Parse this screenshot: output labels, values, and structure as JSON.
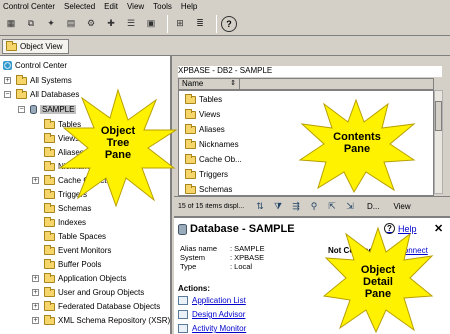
{
  "menu": [
    "Control Center",
    "Selected",
    "Edit",
    "View",
    "Tools",
    "Help"
  ],
  "tab": {
    "label": "Object View"
  },
  "tree": {
    "root": "Control Center",
    "all_systems": "All Systems",
    "all_databases": "All Databases",
    "database": "SAMPLE",
    "items": [
      "Tables",
      "Views",
      "Aliases",
      "Nicknames",
      "Cache Objects",
      "Triggers",
      "Schemas",
      "Indexes",
      "Table Spaces",
      "Event Monitors",
      "Buffer Pools",
      "Application Objects",
      "User and Group Objects",
      "Federated Database Objects",
      "XML Schema Repository (XSR)"
    ]
  },
  "contents": {
    "path": "XPBASE - DB2 - SAMPLE",
    "column": "Name",
    "items": [
      "Tables",
      "Views",
      "Aliases",
      "Nicknames",
      "Cache Ob...",
      "Triggers",
      "Schemas"
    ],
    "count_text": "15 of 15 items displ...",
    "default_btn": "D...",
    "view_btn": "View"
  },
  "detail": {
    "title": "Database - SAMPLE",
    "help": "Help",
    "close": "✕",
    "props": [
      {
        "key": "Alias name",
        "value": ": SAMPLE"
      },
      {
        "key": "System",
        "value": ": XPBASE"
      },
      {
        "key": "Type",
        "value": ": Local"
      }
    ],
    "status": "Not Connec",
    "connect": "Connect",
    "actions_label": "Actions:",
    "actions": [
      "Application List",
      "Design Advisor",
      "Activity Monitor"
    ]
  },
  "callouts": {
    "tree": "Object\nTree\nPane",
    "contents": "Contents\nPane",
    "detail": "Object\nDetail\nPane"
  },
  "colors": {
    "burst_fill": "#fff200",
    "burst_stroke": "#b8a000",
    "link": "#0000cc"
  }
}
